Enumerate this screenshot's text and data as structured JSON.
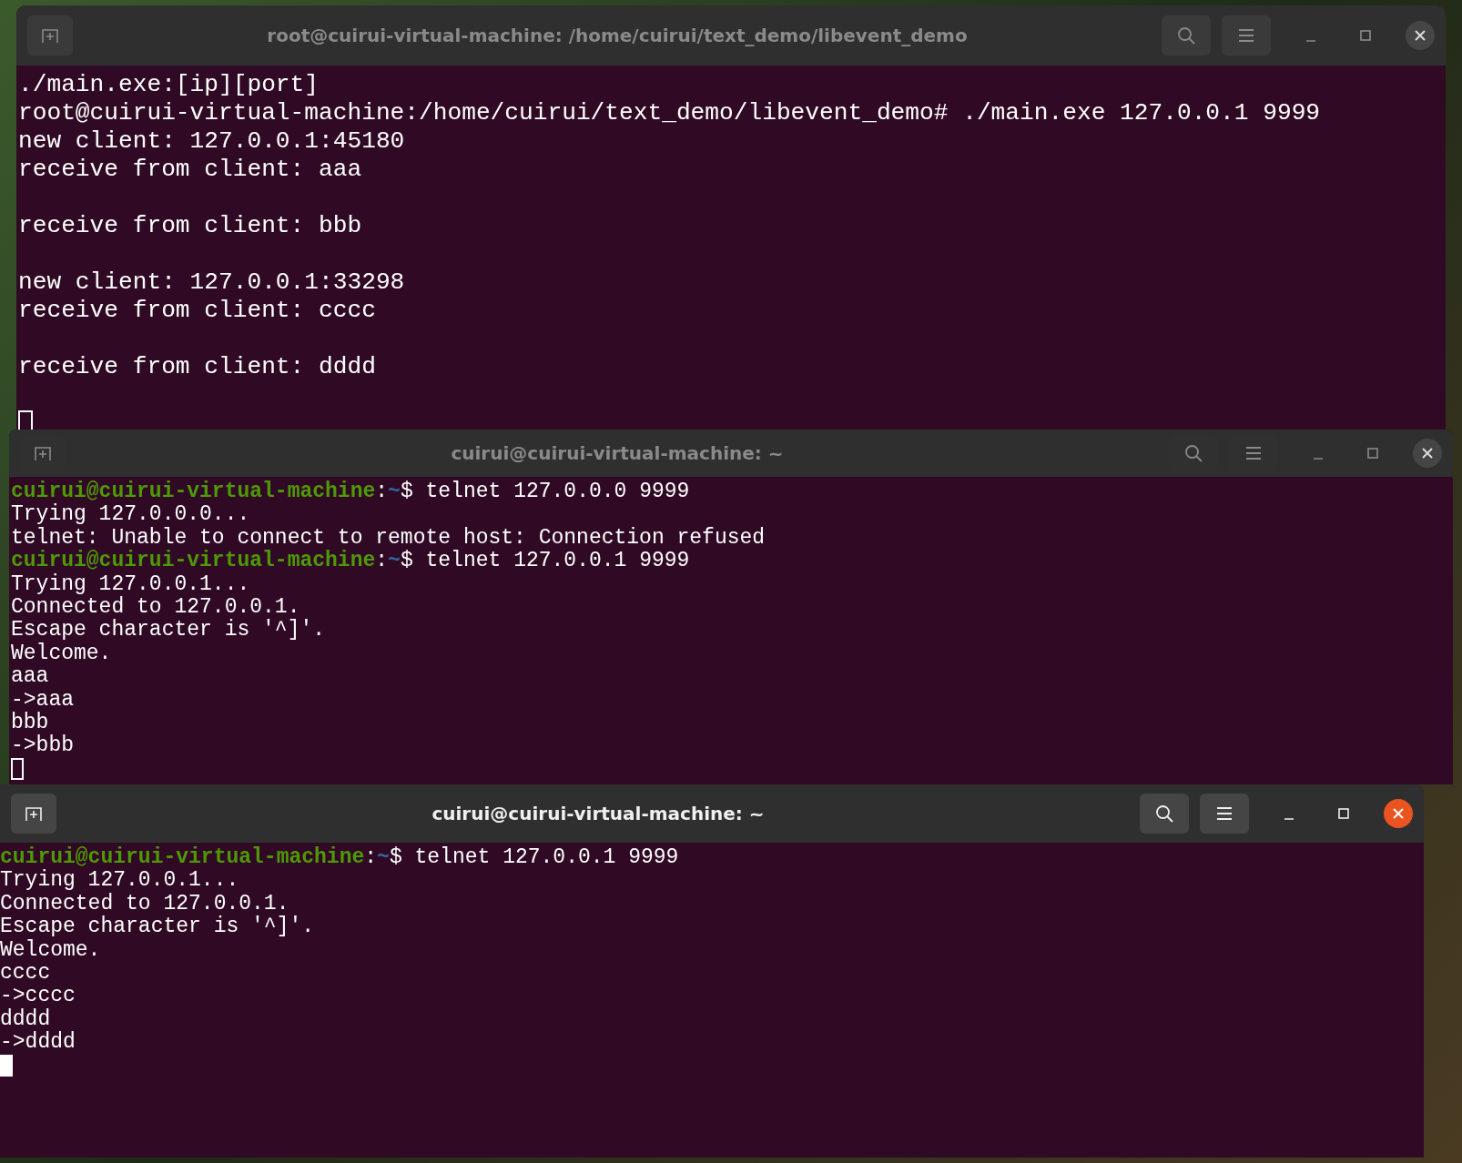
{
  "windows": [
    {
      "title": "root@cuirui-virtual-machine: /home/cuirui/text_demo/libevent_demo",
      "active": false,
      "lines": [
        {
          "kind": "output",
          "text": "./main.exe:[ip][port]"
        },
        {
          "kind": "output",
          "text": "root@cuirui-virtual-machine:/home/cuirui/text_demo/libevent_demo# ./main.exe 127.0.0.1 9999"
        },
        {
          "kind": "output",
          "text": "new client: 127.0.0.1:45180"
        },
        {
          "kind": "output",
          "text": "receive from client: aaa"
        },
        {
          "kind": "blank"
        },
        {
          "kind": "output",
          "text": "receive from client: bbb"
        },
        {
          "kind": "blank"
        },
        {
          "kind": "output",
          "text": "new client: 127.0.0.1:33298"
        },
        {
          "kind": "output",
          "text": "receive from client: cccc"
        },
        {
          "kind": "blank"
        },
        {
          "kind": "output",
          "text": "receive from client: dddd"
        },
        {
          "kind": "blank"
        },
        {
          "kind": "cursor"
        }
      ]
    },
    {
      "title": "cuirui@cuirui-virtual-machine: ~",
      "active": false,
      "lines": [
        {
          "kind": "prompt",
          "host": "cuirui@cuirui-virtual-machine",
          "sep": ":",
          "path": "~",
          "symbol": "$",
          "command": "telnet 127.0.0.0 9999"
        },
        {
          "kind": "output",
          "text": "Trying 127.0.0.0..."
        },
        {
          "kind": "output",
          "text": "telnet: Unable to connect to remote host: Connection refused"
        },
        {
          "kind": "prompt",
          "host": "cuirui@cuirui-virtual-machine",
          "sep": ":",
          "path": "~",
          "symbol": "$",
          "command": "telnet 127.0.0.1 9999"
        },
        {
          "kind": "output",
          "text": "Trying 127.0.0.1..."
        },
        {
          "kind": "output",
          "text": "Connected to 127.0.0.1."
        },
        {
          "kind": "output",
          "text": "Escape character is '^]'."
        },
        {
          "kind": "output",
          "text": "Welcome."
        },
        {
          "kind": "output",
          "text": "aaa"
        },
        {
          "kind": "output",
          "text": "->aaa"
        },
        {
          "kind": "output",
          "text": "bbb"
        },
        {
          "kind": "output",
          "text": "->bbb"
        },
        {
          "kind": "cursor"
        }
      ]
    },
    {
      "title": "cuirui@cuirui-virtual-machine: ~",
      "active": true,
      "lines": [
        {
          "kind": "prompt",
          "host": "cuirui@cuirui-virtual-machine",
          "sep": ":",
          "path": "~",
          "symbol": "$",
          "command": "telnet 127.0.0.1 9999"
        },
        {
          "kind": "output",
          "text": "Trying 127.0.0.1..."
        },
        {
          "kind": "output",
          "text": "Connected to 127.0.0.1."
        },
        {
          "kind": "output",
          "text": "Escape character is '^]'."
        },
        {
          "kind": "output",
          "text": "Welcome."
        },
        {
          "kind": "output",
          "text": "cccc"
        },
        {
          "kind": "output",
          "text": "->cccc"
        },
        {
          "kind": "output",
          "text": "dddd"
        },
        {
          "kind": "output",
          "text": "->dddd"
        },
        {
          "kind": "cursor"
        }
      ]
    }
  ]
}
